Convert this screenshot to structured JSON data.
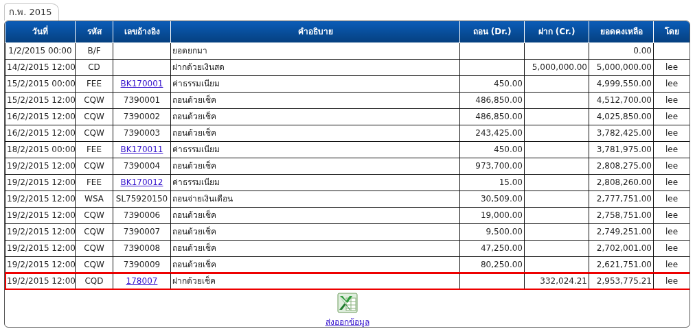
{
  "tab": {
    "label": "ก.พ. 2015",
    "selected": true
  },
  "table": {
    "columns": [
      "วันที่",
      "รหัส",
      "เลขอ้างอิง",
      "คำอธิบาย",
      "ถอน (Dr.)",
      "ฝาก (Cr.)",
      "ยอดคงเหลือ",
      "โดย"
    ],
    "rows": [
      {
        "date": "1/2/2015 00:00",
        "code": "B/F",
        "description": "ยอดยกมา",
        "balance": "0.00",
        "highlighted": false
      },
      {
        "date": "14/2/2015 12:00",
        "code": "CD",
        "description": "ฝากด้วยเงินสด",
        "credit": "5,000,000.00",
        "balance": "5,000,000.00",
        "by": "lee",
        "highlighted": false
      },
      {
        "date": "15/2/2015 00:00",
        "code": "FEE",
        "ref": {
          "text": "BK170001",
          "link": true
        },
        "description": "ค่าธรรมเนียม",
        "debit": "450.00",
        "balance": "4,999,550.00",
        "by": "lee",
        "highlighted": false
      },
      {
        "date": "15/2/2015 12:00",
        "code": "CQW",
        "ref": {
          "text": "7390001",
          "link": false
        },
        "description": "ถอนด้วยเช็ค",
        "debit": "486,850.00",
        "balance": "4,512,700.00",
        "by": "lee",
        "highlighted": false
      },
      {
        "date": "16/2/2015 12:00",
        "code": "CQW",
        "ref": {
          "text": "7390002",
          "link": false
        },
        "description": "ถอนด้วยเช็ค",
        "debit": "486,850.00",
        "balance": "4,025,850.00",
        "by": "lee",
        "highlighted": false
      },
      {
        "date": "16/2/2015 12:00",
        "code": "CQW",
        "ref": {
          "text": "7390003",
          "link": false
        },
        "description": "ถอนด้วยเช็ค",
        "debit": "243,425.00",
        "balance": "3,782,425.00",
        "by": "lee",
        "highlighted": false
      },
      {
        "date": "18/2/2015 00:00",
        "code": "FEE",
        "ref": {
          "text": "BK170011",
          "link": true
        },
        "description": "ค่าธรรมเนียม",
        "debit": "450.00",
        "balance": "3,781,975.00",
        "by": "lee",
        "highlighted": false
      },
      {
        "date": "19/2/2015 12:00",
        "code": "CQW",
        "ref": {
          "text": "7390004",
          "link": false
        },
        "description": "ถอนด้วยเช็ค",
        "debit": "973,700.00",
        "balance": "2,808,275.00",
        "by": "lee",
        "highlighted": false
      },
      {
        "date": "19/2/2015 12:00",
        "code": "FEE",
        "ref": {
          "text": "BK170012",
          "link": true
        },
        "description": "ค่าธรรมเนียม",
        "debit": "15.00",
        "balance": "2,808,260.00",
        "by": "lee",
        "highlighted": false
      },
      {
        "date": "19/2/2015 12:00",
        "code": "WSA",
        "ref": {
          "text": "SL75920150",
          "link": false
        },
        "description": "ถอนจ่ายเงินเดือน",
        "debit": "30,509.00",
        "balance": "2,777,751.00",
        "by": "lee",
        "highlighted": false
      },
      {
        "date": "19/2/2015 12:00",
        "code": "CQW",
        "ref": {
          "text": "7390006",
          "link": false
        },
        "description": "ถอนด้วยเช็ค",
        "debit": "19,000.00",
        "balance": "2,758,751.00",
        "by": "lee",
        "highlighted": false
      },
      {
        "date": "19/2/2015 12:00",
        "code": "CQW",
        "ref": {
          "text": "7390007",
          "link": false
        },
        "description": "ถอนด้วยเช็ค",
        "debit": "9,500.00",
        "balance": "2,749,251.00",
        "by": "lee",
        "highlighted": false
      },
      {
        "date": "19/2/2015 12:00",
        "code": "CQW",
        "ref": {
          "text": "7390008",
          "link": false
        },
        "description": "ถอนด้วยเช็ค",
        "debit": "47,250.00",
        "balance": "2,702,001.00",
        "by": "lee",
        "highlighted": false
      },
      {
        "date": "19/2/2015 12:00",
        "code": "CQW",
        "ref": {
          "text": "7390009",
          "link": false
        },
        "description": "ถอนด้วยเช็ค",
        "debit": "80,250.00",
        "balance": "2,621,751.00",
        "by": "lee",
        "highlighted": false
      },
      {
        "date": "19/2/2015 12:00",
        "code": "CQD",
        "ref": {
          "text": "178007",
          "link": true
        },
        "description": "ฝากด้วยเช็ค",
        "credit": "332,024.21",
        "balance": "2,953,775.21",
        "by": "lee",
        "highlighted": true
      }
    ]
  },
  "export": {
    "label": "ส่งออกข้อมูล"
  }
}
